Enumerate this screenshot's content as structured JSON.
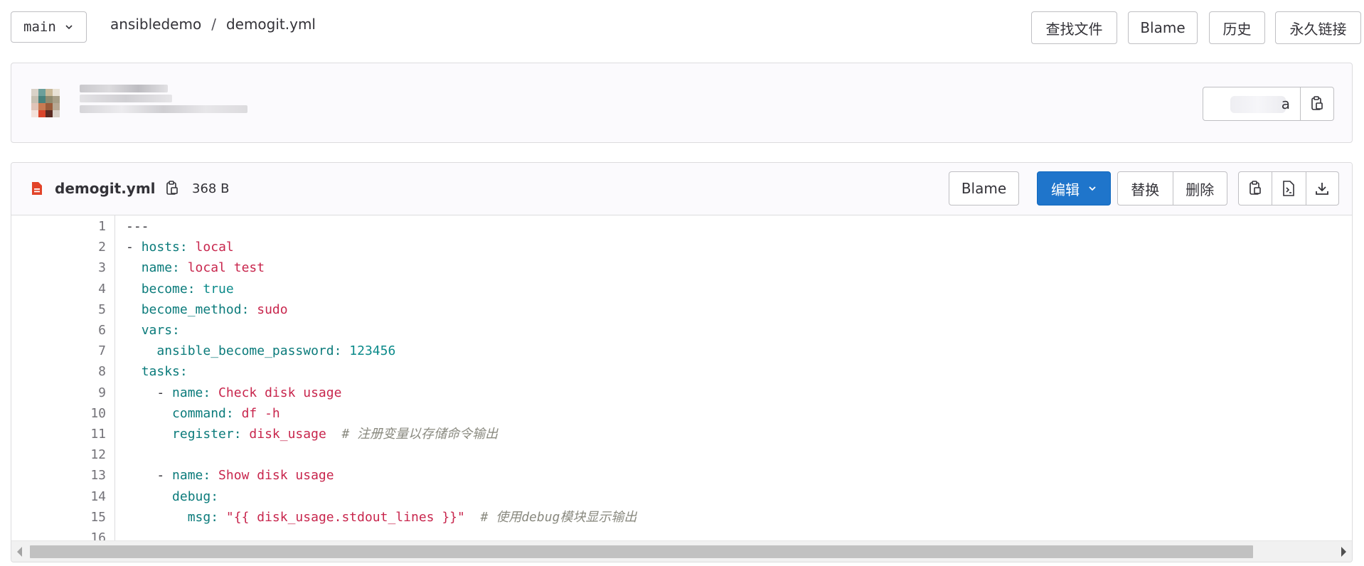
{
  "branch": {
    "name": "main"
  },
  "breadcrumb": {
    "project": "ansibledemo",
    "separator": "/",
    "file": "demogit.yml"
  },
  "top_actions": {
    "find_file": "查找文件",
    "blame": "Blame",
    "history": "历史",
    "permalink": "永久链接"
  },
  "commit": {
    "sha_prefix": "",
    "sha_suffix": "a"
  },
  "file": {
    "name": "demogit.yml",
    "size": "368 B",
    "blame_label": "Blame",
    "edit_label": "编辑",
    "replace_label": "替换",
    "delete_label": "删除"
  },
  "code_lines": [
    [
      {
        "t": "---",
        "c": "p"
      }
    ],
    [
      {
        "t": "- ",
        "c": "p"
      },
      {
        "t": "hosts:",
        "c": "k"
      },
      {
        "t": " local",
        "c": "s"
      }
    ],
    [
      {
        "t": "  ",
        "c": "p"
      },
      {
        "t": "name:",
        "c": "k"
      },
      {
        "t": " local test",
        "c": "s"
      }
    ],
    [
      {
        "t": "  ",
        "c": "p"
      },
      {
        "t": "become:",
        "c": "k"
      },
      {
        "t": " true",
        "c": "n"
      }
    ],
    [
      {
        "t": "  ",
        "c": "p"
      },
      {
        "t": "become_method:",
        "c": "k"
      },
      {
        "t": " sudo",
        "c": "s"
      }
    ],
    [
      {
        "t": "  ",
        "c": "p"
      },
      {
        "t": "vars:",
        "c": "k"
      }
    ],
    [
      {
        "t": "    ",
        "c": "p"
      },
      {
        "t": "ansible_become_password:",
        "c": "k"
      },
      {
        "t": " 123456",
        "c": "n"
      }
    ],
    [
      {
        "t": "  ",
        "c": "p"
      },
      {
        "t": "tasks:",
        "c": "k"
      }
    ],
    [
      {
        "t": "    - ",
        "c": "p"
      },
      {
        "t": "name:",
        "c": "k"
      },
      {
        "t": " Check disk usage",
        "c": "s"
      }
    ],
    [
      {
        "t": "      ",
        "c": "p"
      },
      {
        "t": "command:",
        "c": "k"
      },
      {
        "t": " df -h",
        "c": "s"
      }
    ],
    [
      {
        "t": "      ",
        "c": "p"
      },
      {
        "t": "register:",
        "c": "k"
      },
      {
        "t": " disk_usage",
        "c": "s"
      },
      {
        "t": "  # 注册变量以存储命令输出",
        "c": "c"
      }
    ],
    [],
    [
      {
        "t": "    - ",
        "c": "p"
      },
      {
        "t": "name:",
        "c": "k"
      },
      {
        "t": " Show disk usage",
        "c": "s"
      }
    ],
    [
      {
        "t": "      ",
        "c": "p"
      },
      {
        "t": "debug:",
        "c": "k"
      }
    ],
    [
      {
        "t": "        ",
        "c": "p"
      },
      {
        "t": "msg:",
        "c": "k"
      },
      {
        "t": " \"{{ disk_usage.stdout_lines }}\"",
        "c": "s"
      },
      {
        "t": "  # 使用debug模块显示输出",
        "c": "c"
      }
    ],
    []
  ],
  "colors": {
    "primary": "#1f75cb",
    "key": "#0b7b7b",
    "string": "#c8264d",
    "number": "#0b8a8a",
    "comment": "#8a8a80"
  }
}
